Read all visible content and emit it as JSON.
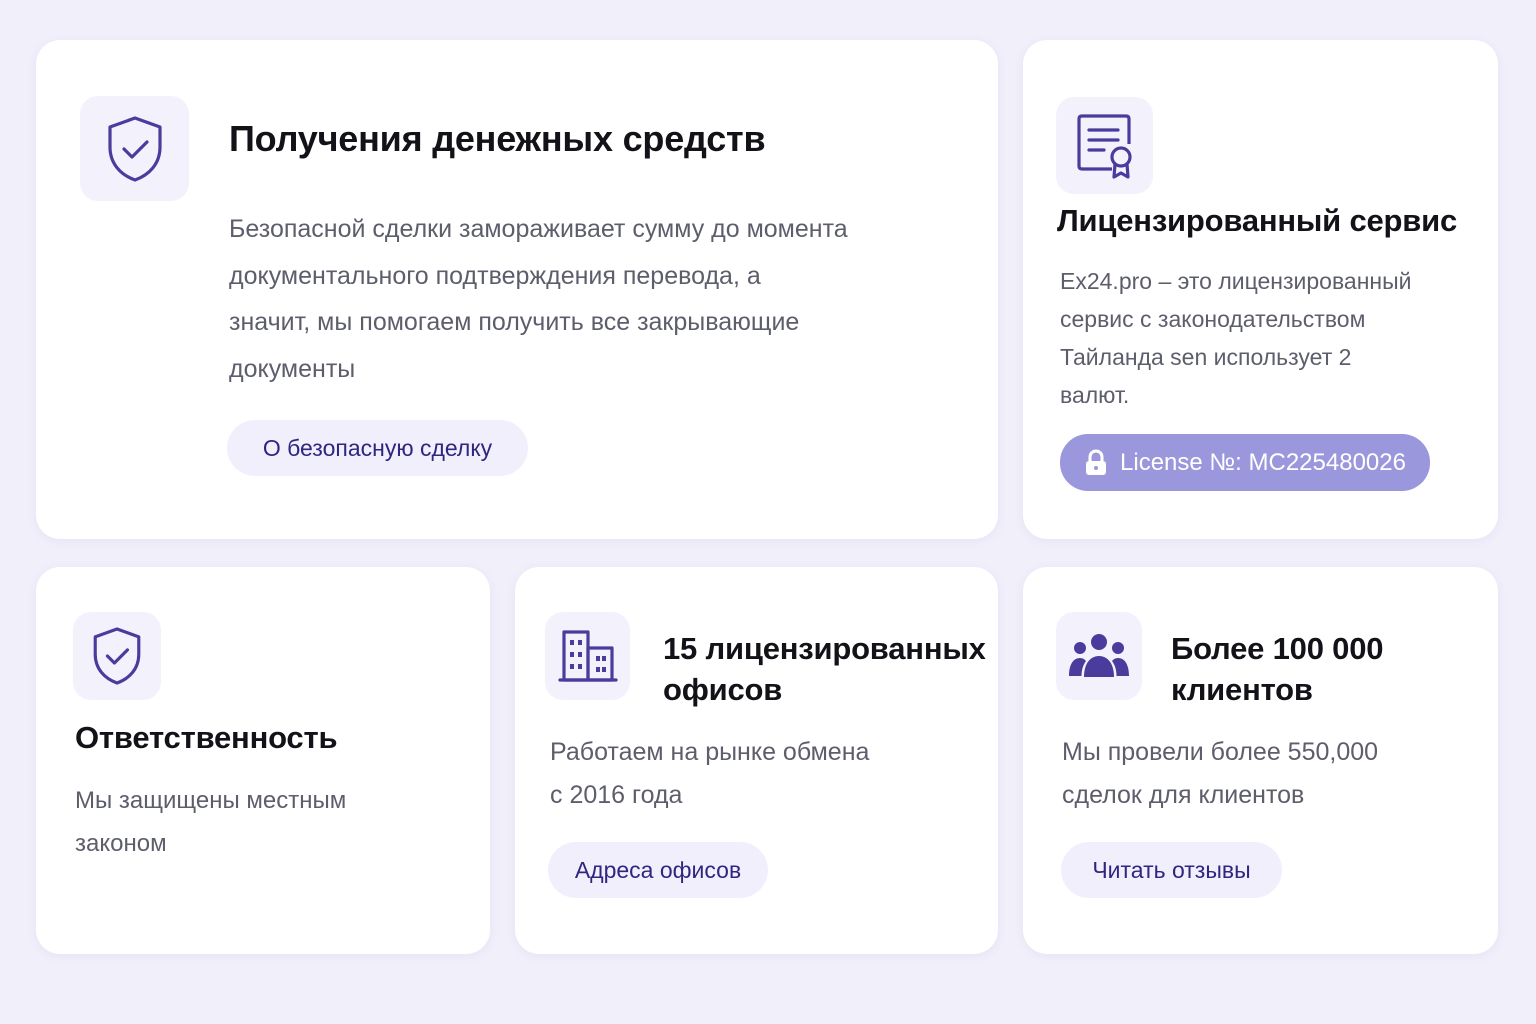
{
  "colors": {
    "page_background": "#f0effa",
    "card_background": "#ffffff",
    "icon_box_background": "#f3f1fc",
    "icon_stroke": "#4a3c9c",
    "pill_background": "#f1effc",
    "pill_text": "#2f2680",
    "license_badge": "#9b97dc"
  },
  "cards": {
    "funds": {
      "icon": "shield-check-icon",
      "title": "Получения денежных средств",
      "desc_lines": [
        "Безопасной сделки замораживает сумму до момента",
        "документального подтверждения перевода, а",
        "значит, мы помогаем получить все закрывающие",
        "документы"
      ],
      "button": "О безопасную сделку"
    },
    "license": {
      "icon": "certificate-icon",
      "title": "Лицензированный сервис",
      "desc_lines": [
        "Ex24.pro – это лицензированный",
        "сервис с законодательством",
        "Тайланда sen использует 2",
        "валют."
      ],
      "badge_icon": "lock-icon",
      "badge": "License №: MC225480026"
    },
    "responsibility": {
      "icon": "shield-check-icon",
      "title": "Ответственность",
      "desc_lines": [
        "Мы защищены местным",
        "законом"
      ]
    },
    "offices": {
      "icon": "building-icon",
      "title_lines": [
        "15 лицензированных",
        "офисов"
      ],
      "desc_lines": [
        "Работаем на рынке обмена",
        "с 2016 года"
      ],
      "button": "Адреса офисов"
    },
    "clients": {
      "icon": "users-group-icon",
      "title_lines": [
        "Более 100 000",
        "клиентов"
      ],
      "desc_lines": [
        "Мы провели более 550,000",
        "сделок для клиентов"
      ],
      "button": "Читать отзывы"
    }
  }
}
